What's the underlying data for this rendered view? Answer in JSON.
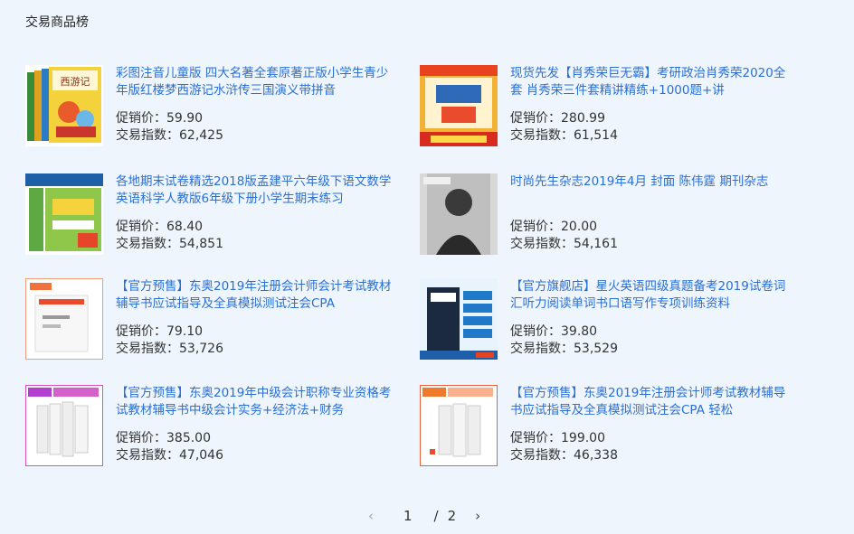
{
  "panel": {
    "title": "交易商品榜"
  },
  "labels": {
    "price": "促销价：",
    "index": "交易指数："
  },
  "items": [
    {
      "title": "彩图注音儿童版 四大名著全套原著正版小学生青少年版红楼梦西游记水浒传三国演义带拼音",
      "price": "59.90",
      "index": "62,425",
      "thumb": "book-set-icon"
    },
    {
      "title": "现货先发【肖秀荣巨无霸】考研政治肖秀荣2020全套 肖秀荣三件套精讲精练+1000题+讲",
      "price": "280.99",
      "index": "61,514",
      "thumb": "exam-book-icon"
    },
    {
      "title": "各地期末试卷精选2018版孟建平六年级下语文数学英语科学人教版6年级下册小学生期末练习",
      "price": "68.40",
      "index": "54,851",
      "thumb": "workbook-icon"
    },
    {
      "title": "时尚先生杂志2019年4月 封面 陈伟霆 期刊杂志",
      "price": "20.00",
      "index": "54,161",
      "thumb": "magazine-icon"
    },
    {
      "title": "【官方预售】东奥2019年注册会计师会计考试教材辅导书应试指导及全真模拟测试注会CPA",
      "price": "79.10",
      "index": "53,726",
      "thumb": "accounting-book-icon"
    },
    {
      "title": "【官方旗舰店】星火英语四级真题备考2019试卷词汇听力阅读单词书口语写作专项训练资料",
      "price": "39.80",
      "index": "53,529",
      "thumb": "spark-book-icon"
    },
    {
      "title": "【官方预售】东奥2019年中级会计职称专业资格考试教材辅导书中级会计实务+经济法+财务",
      "price": "385.00",
      "index": "47,046",
      "thumb": "accounting-set-icon"
    },
    {
      "title": "【官方预售】东奥2019年注册会计师考试教材辅导书应试指导及全真模拟测试注会CPA 轻松",
      "price": "199.00",
      "index": "46,338",
      "thumb": "accounting-guide-icon"
    }
  ],
  "pager": {
    "prev": "‹",
    "current": "1",
    "separator": "/",
    "total": "2",
    "next": "›"
  }
}
